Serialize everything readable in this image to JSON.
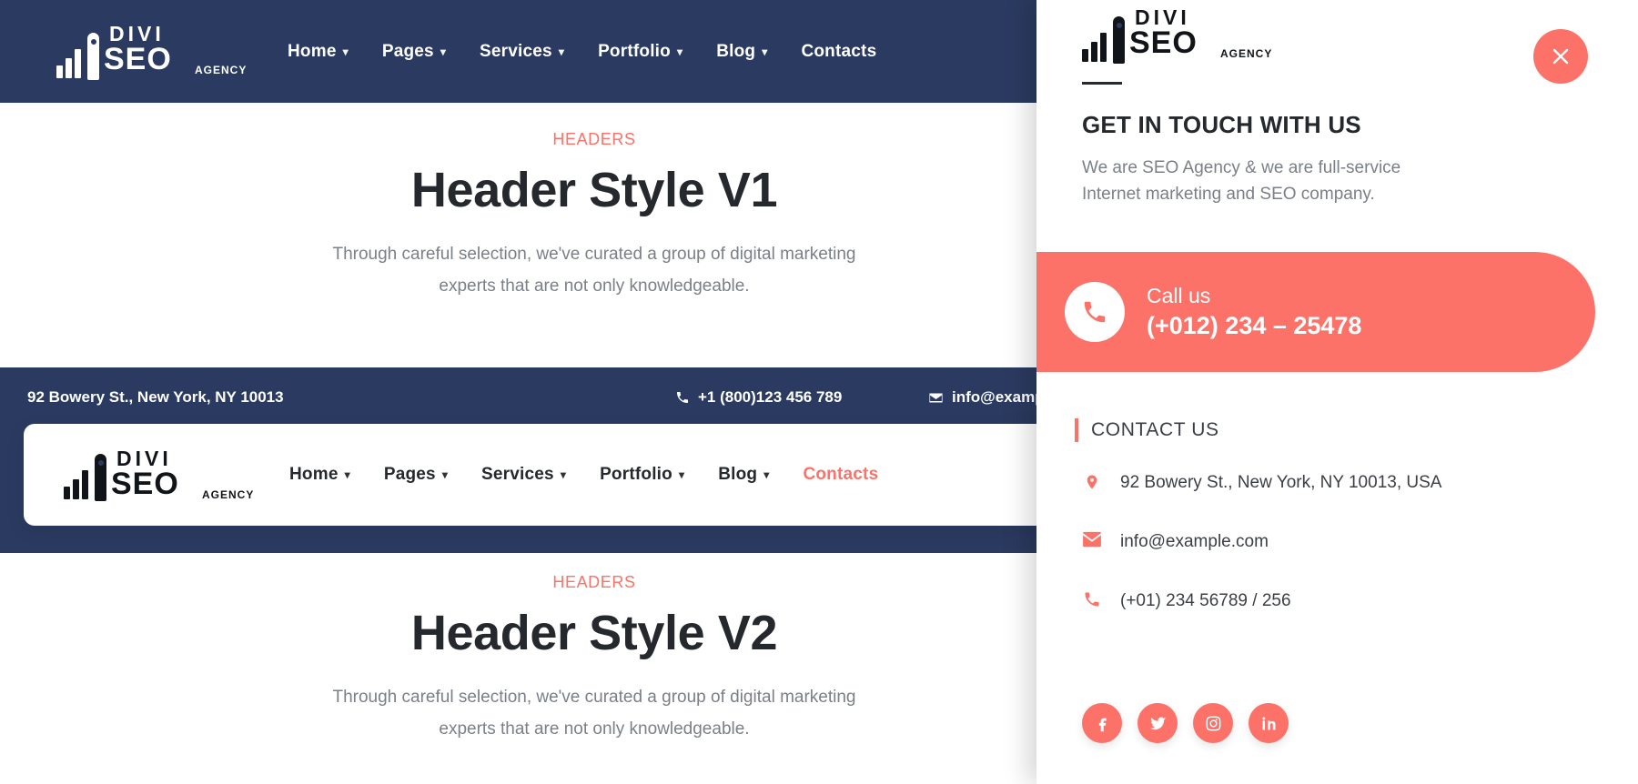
{
  "brand": {
    "logo_divi": "DIVI",
    "logo_seo": "SEO",
    "logo_agency": "AGENCY",
    "accent_color": "#fc7268",
    "navy_color": "#2b3a60",
    "text_color": "#25282c"
  },
  "navbar_v1": {
    "items": [
      {
        "label": "Home",
        "has_dropdown": true
      },
      {
        "label": "Pages",
        "has_dropdown": true
      },
      {
        "label": "Services",
        "has_dropdown": true
      },
      {
        "label": "Portfolio",
        "has_dropdown": true
      },
      {
        "label": "Blog",
        "has_dropdown": true
      },
      {
        "label": "Contacts",
        "has_dropdown": false
      }
    ],
    "chevron": "⌄",
    "search_icon": "search-icon"
  },
  "navbar_v2": {
    "items": [
      {
        "label": "Home",
        "has_dropdown": true,
        "active": false
      },
      {
        "label": "Pages",
        "has_dropdown": true,
        "active": false
      },
      {
        "label": "Services",
        "has_dropdown": true,
        "active": false
      },
      {
        "label": "Portfolio",
        "has_dropdown": true,
        "active": false
      },
      {
        "label": "Blog",
        "has_dropdown": true,
        "active": false
      },
      {
        "label": "Contacts",
        "has_dropdown": false,
        "active": true
      }
    ]
  },
  "hero_v1": {
    "eyebrow": "HEADERS",
    "title": "Header Style V1",
    "subtitle": "Through careful selection, we've curated a group of digital marketing experts that are not only knowledgeable."
  },
  "hero_v2": {
    "eyebrow": "HEADERS",
    "title": "Header Style V2",
    "subtitle": "Through careful selection, we've curated a group of digital marketing experts that are not only knowledgeable."
  },
  "infobar": {
    "address": "92 Bowery St., New York, NY 10013",
    "phone": "+1 (800)123 456 789",
    "email": "info@example.com",
    "phone_icon": "phone-icon",
    "email_icon": "envelope-icon",
    "search_icon": "search-icon"
  },
  "sidebar": {
    "close_label": "close-icon",
    "title": "GET IN TOUCH WITH US",
    "description": "We are SEO Agency & we are full-service Internet marketing and SEO company.",
    "call": {
      "label": "Call us",
      "number": "(+012) 234 – 25478",
      "icon": "phone-icon"
    },
    "contact_heading": "CONTACT US",
    "contacts": [
      {
        "icon": "map-pin-icon",
        "text": "92 Bowery St., New York, NY 10013, USA"
      },
      {
        "icon": "envelope-icon",
        "text": "info@example.com"
      },
      {
        "icon": "phone-icon",
        "text": "(+01) 234 56789 / 256"
      }
    ],
    "socials": [
      {
        "icon": "facebook-icon",
        "label": "Facebook"
      },
      {
        "icon": "twitter-icon",
        "label": "Twitter"
      },
      {
        "icon": "instagram-icon",
        "label": "Instagram"
      },
      {
        "icon": "linkedin-icon",
        "label": "LinkedIn"
      }
    ]
  }
}
